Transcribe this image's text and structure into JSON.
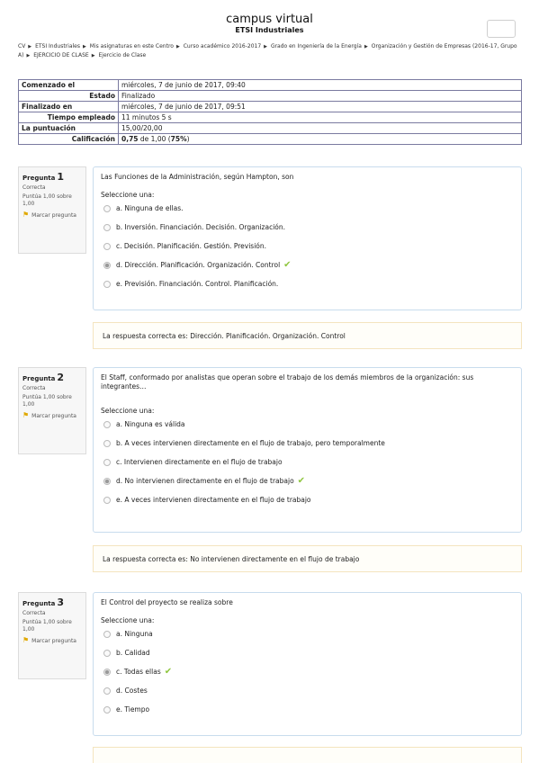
{
  "header": {
    "title": "campus virtual",
    "subtitle": "ETSI Industriales"
  },
  "breadcrumb": [
    "CV",
    "ETSI Industriales",
    "Mis asignaturas en este Centro",
    "Curso académico 2016-2017",
    "Grado en Ingeniería de la Energía",
    "Organización y Gestión de Empresas (2016-17, Grupo A)",
    "EJERCICIO DE CLASE",
    "Ejercicio de Clase"
  ],
  "summary": {
    "started_label": "Comenzado el",
    "started": "miércoles, 7 de junio de 2017, 09:40",
    "state_label": "Estado",
    "state": "Finalizado",
    "finished_label": "Finalizado en",
    "finished": "miércoles, 7 de junio de 2017, 09:51",
    "time_label": "Tiempo empleado",
    "time": "11 minutos 5 s",
    "marks_label": "La puntuación",
    "marks": "15,00/20,00",
    "grade_label": "Calificación",
    "grade_value": "0,75",
    "grade_rest": " de 1,00 (",
    "grade_pct": "75%",
    "grade_close": ")"
  },
  "common": {
    "question_label": "Pregunta",
    "state": "Correcta",
    "grade": "Puntúa 1,00 sobre 1,00",
    "flag": "Marcar pregunta",
    "prompt": "Seleccione una:"
  },
  "questions": [
    {
      "number": "1",
      "text": "Las Funciones de la Administración, según Hampton, son",
      "options": [
        "a. Ninguna de ellas.",
        "b. Inversión. Financiación. Decisión. Organización.",
        "c. Decisión. Planificación. Gestión. Previsión.",
        "d. Dirección. Planificación. Organización. Control",
        "e. Previsión. Financiación. Control. Planificación."
      ],
      "selected": 3,
      "feedback": "La respuesta correcta es: Dirección. Planificación. Organización. Control"
    },
    {
      "number": "2",
      "text": "El Staff, conformado por analistas que operan sobre el trabajo de los demás miembros de la organización: sus integrantes…",
      "options": [
        "a. Ninguna es válida",
        "b. A veces intervienen directamente en el flujo de trabajo, pero temporalmente",
        "c. Intervienen directamente en el flujo de trabajo",
        "d. No intervienen directamente en el flujo de trabajo",
        "e. A veces intervienen directamente en el flujo de trabajo"
      ],
      "selected": 3,
      "feedback": "La respuesta correcta es: No intervienen directamente en el flujo de trabajo"
    },
    {
      "number": "3",
      "text": "El Control del proyecto se realiza sobre",
      "options": [
        "a. Ninguna",
        "b. Calidad",
        "c. Todas ellas",
        "d. Costes",
        "e. Tiempo"
      ],
      "selected": 2
    }
  ],
  "icons": {
    "flag": "flag-icon",
    "check": "check-icon",
    "separator": "triangle-right-icon"
  },
  "colors": {
    "check": "#8fc63f",
    "flag": "#e0a800",
    "question_border": "#c8dced",
    "feedback_border": "#f4e4bf"
  }
}
